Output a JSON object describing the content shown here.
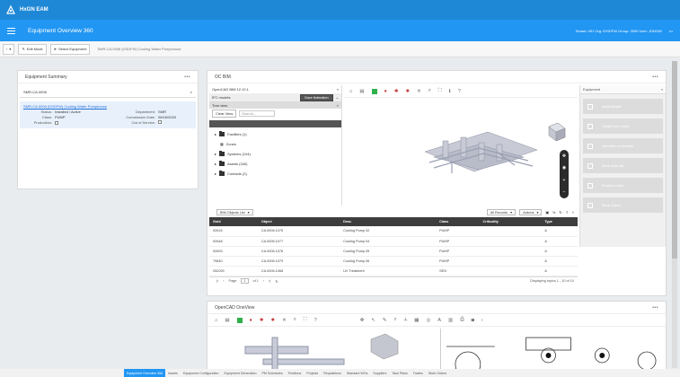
{
  "app": {
    "brand": "HxGN EAM"
  },
  "header": {
    "page_title": "Equipment Overview 360",
    "tenant_info": "Tenant: 451  Org: IDSDFW  Group: 2500  User: JDNOW",
    "more": "•••"
  },
  "toolbar": {
    "back": "‹",
    "edit_mode": "Edit Mode",
    "select_equipment": "Select Equipment",
    "breadcrumb": "SMR-CA.0006 (DSDFW) Cooling Water Pumphouse"
  },
  "summary": {
    "title": "Equipment Summary",
    "more": "•••",
    "search_value": "SMR-CA.0006",
    "record": {
      "link": "SMR-CA.0006 (DSDFW) Cooling Water Pumphouse",
      "status_label": "Status:",
      "status_value": "Installed / Active",
      "class_label": "Class:",
      "class_value": "PUMP",
      "production_label": "Production:",
      "department_label": "Department:",
      "department_value": "SMR",
      "commission_label": "Commission Date:",
      "commission_value": "06/16/2020",
      "oos_label": "Out of Service:"
    }
  },
  "ocbim": {
    "title": "OC BIM",
    "more": "•••",
    "tree": {
      "model_title": "OpenCAD BIM 12.10.1",
      "ifc_label": "IFC models",
      "save_federation": "Save federation",
      "tree_view": "Tree view",
      "clear_view": "Clear View",
      "search_placeholder": "Search...",
      "nodes": [
        "Facilities (1)",
        "Zones",
        "Systems (104)",
        "Assets (340)",
        "Contacts (2)"
      ]
    },
    "equipment_panel": {
      "title": "Equipment",
      "actions": [
        "Asset details",
        "Create work order",
        "View item conformity",
        "Work order list",
        "Permit to work",
        "Work Orders"
      ]
    },
    "table": {
      "object_list": "BIM Objects List",
      "all_records": "All Records",
      "actions": "Actions",
      "columns": [
        "Guid",
        "Object",
        "Desc",
        "Class",
        "Criticality",
        "Type"
      ],
      "rows": [
        [
          "92615",
          "CA.0006.1075",
          "Cooling Pump 02",
          "PUMP",
          "",
          "A"
        ],
        [
          "92648",
          "CA.0006.1077",
          "Cooling Pump 04",
          "PUMP",
          "",
          "A"
        ],
        [
          "92693",
          "CA.0006.1078",
          "Cooling Pump 05",
          "PUMP",
          "",
          "A"
        ],
        [
          "79840",
          "CA.0006.1079",
          "Cooling Pump 06",
          "PUMP",
          "",
          "A"
        ],
        [
          "252029",
          "CA.0006.1068",
          "UV Treatment",
          "SEN",
          "",
          "A"
        ]
      ],
      "page_label": "Page",
      "page_value": "1",
      "page_of": "of 1",
      "displaying": "Displaying topics 1 - 10 of 10"
    }
  },
  "oneview": {
    "title": "OpenCAD OneView",
    "more": "•••"
  },
  "bottom_tabs": [
    "Equipment Overview 360",
    "Assets",
    "Equipment Configuration",
    "Equipment Generation",
    "PM Schedules",
    "Positions",
    "Projects",
    "Requisitions",
    "Standard WOs",
    "Suppliers",
    "Task Plans",
    "Trades",
    "Work Orders"
  ],
  "colors": {
    "brand_blue": "#2196f3",
    "topbar_blue": "#1e88d6",
    "dark_header": "#3d3d3d",
    "accent_green": "#2fb04a",
    "accent_red": "#c93a3a"
  }
}
